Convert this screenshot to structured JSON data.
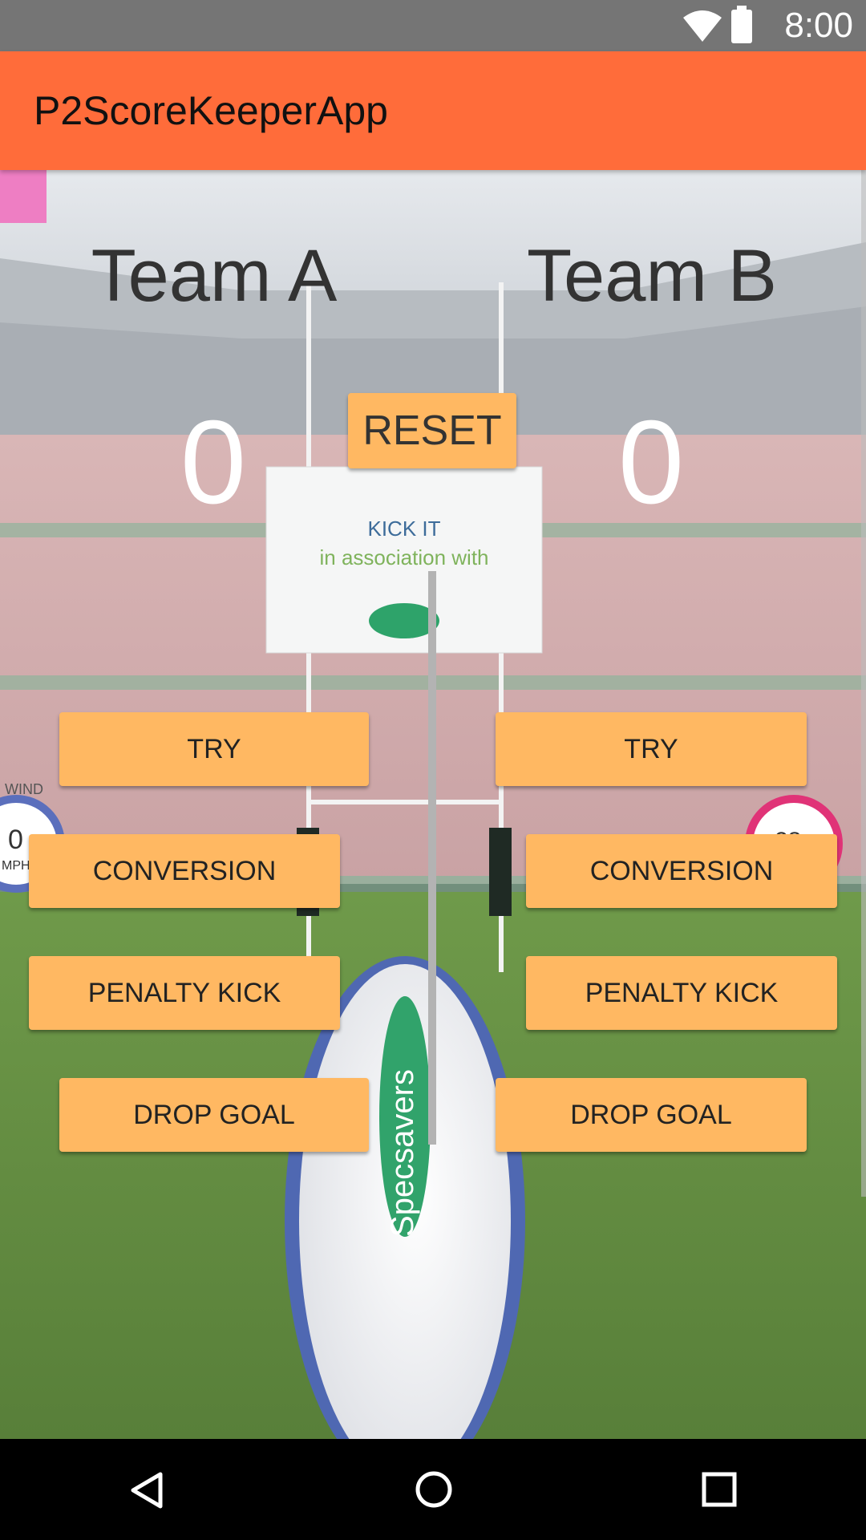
{
  "status_bar": {
    "time": "8:00",
    "icons": [
      "wifi-icon",
      "battery-icon"
    ]
  },
  "app_bar": {
    "title": "P2ScoreKeeperApp"
  },
  "teams": {
    "a": {
      "name": "Team A",
      "score": "0"
    },
    "b": {
      "name": "Team B",
      "score": "0"
    }
  },
  "reset_label": "RESET",
  "buttons": {
    "try": "TRY",
    "conversion": "CONVERSION",
    "penalty_kick": "PENALTY KICK",
    "drop_goal": "DROP GOAL"
  },
  "background": {
    "board_line1": "KICK IT",
    "board_line2": "in association with",
    "brand": "Specsavers",
    "wind_label": "WIND",
    "wind_value": "0",
    "wind_unit": "MPH",
    "gauge_right_value": "28"
  },
  "nav_bar": {
    "icons": [
      "back-icon",
      "home-icon",
      "recents-icon"
    ]
  },
  "colors": {
    "app_bar": "#ff6c3a",
    "button": "#ffb862",
    "status_bar": "#757575"
  }
}
